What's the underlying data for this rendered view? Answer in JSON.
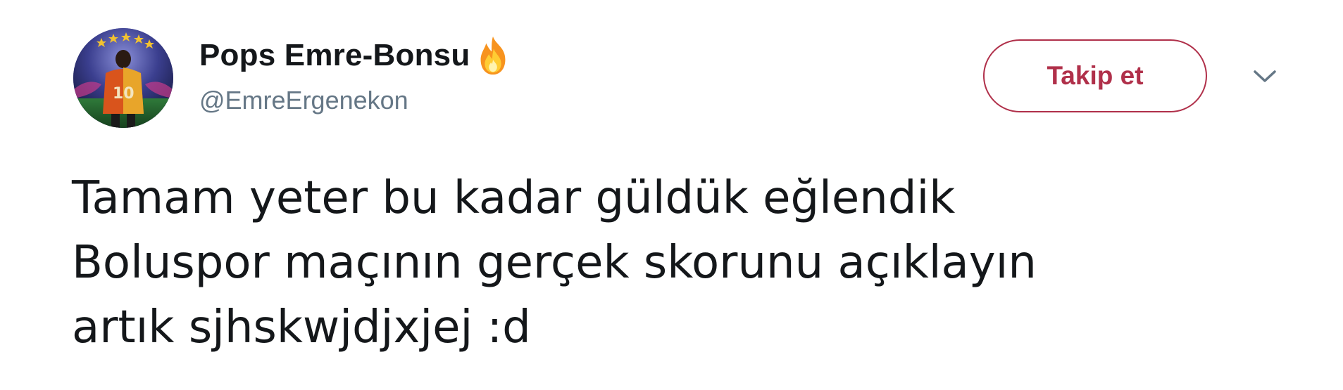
{
  "tweet": {
    "author": {
      "display_name": "Pops Emre-Bonsu",
      "name_emoji": "fire-icon",
      "handle": "@EmreErgenekon",
      "avatar": "avatar-icon"
    },
    "follow_button_label": "Takip et",
    "menu_icon": "chevron-down-icon",
    "text_lines": [
      "Tamam yeter bu kadar güldük eğlendik",
      "Boluspor maçının gerçek skorunu açıklayın",
      "artık sjhskwjdjxjej :d"
    ]
  },
  "colors": {
    "accent": "#b0304a",
    "text_primary": "#14171a",
    "text_secondary": "#657786",
    "background": "#ffffff"
  }
}
